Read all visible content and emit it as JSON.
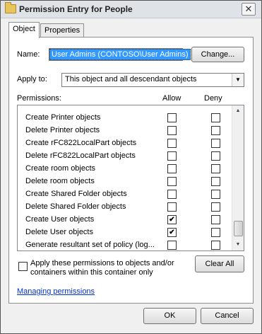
{
  "window": {
    "title": "Permission Entry for People",
    "close_glyph": "✕"
  },
  "tabs": [
    {
      "label": "Object",
      "active": true
    },
    {
      "label": "Properties",
      "active": false
    }
  ],
  "name": {
    "label": "Name:",
    "value": "User Admins (CONTOSO\\User Admins)",
    "change_button": "Change..."
  },
  "apply_to": {
    "label": "Apply to:",
    "value": "This object and all descendant objects"
  },
  "permissions": {
    "header": "Permissions:",
    "allow_header": "Allow",
    "deny_header": "Deny",
    "rows": [
      {
        "name": "Create Printer objects",
        "allow": false,
        "deny": false
      },
      {
        "name": "Delete Printer objects",
        "allow": false,
        "deny": false
      },
      {
        "name": "Create rFC822LocalPart objects",
        "allow": false,
        "deny": false
      },
      {
        "name": "Delete rFC822LocalPart objects",
        "allow": false,
        "deny": false
      },
      {
        "name": "Create room objects",
        "allow": false,
        "deny": false
      },
      {
        "name": "Delete room objects",
        "allow": false,
        "deny": false
      },
      {
        "name": "Create Shared Folder objects",
        "allow": false,
        "deny": false
      },
      {
        "name": "Delete Shared Folder objects",
        "allow": false,
        "deny": false
      },
      {
        "name": "Create User objects",
        "allow": true,
        "deny": false
      },
      {
        "name": "Delete User objects",
        "allow": true,
        "deny": false
      },
      {
        "name": "Generate resultant set of policy (log...",
        "allow": false,
        "deny": false
      }
    ]
  },
  "apply_checkbox": {
    "label_line1": "Apply these permissions to objects and/or",
    "label_line2": "containers within this container only",
    "checked": false
  },
  "clear_all_button": "Clear All",
  "managing_link": "Managing permissions",
  "ok_button": "OK",
  "cancel_button": "Cancel",
  "check_glyph": "✔"
}
